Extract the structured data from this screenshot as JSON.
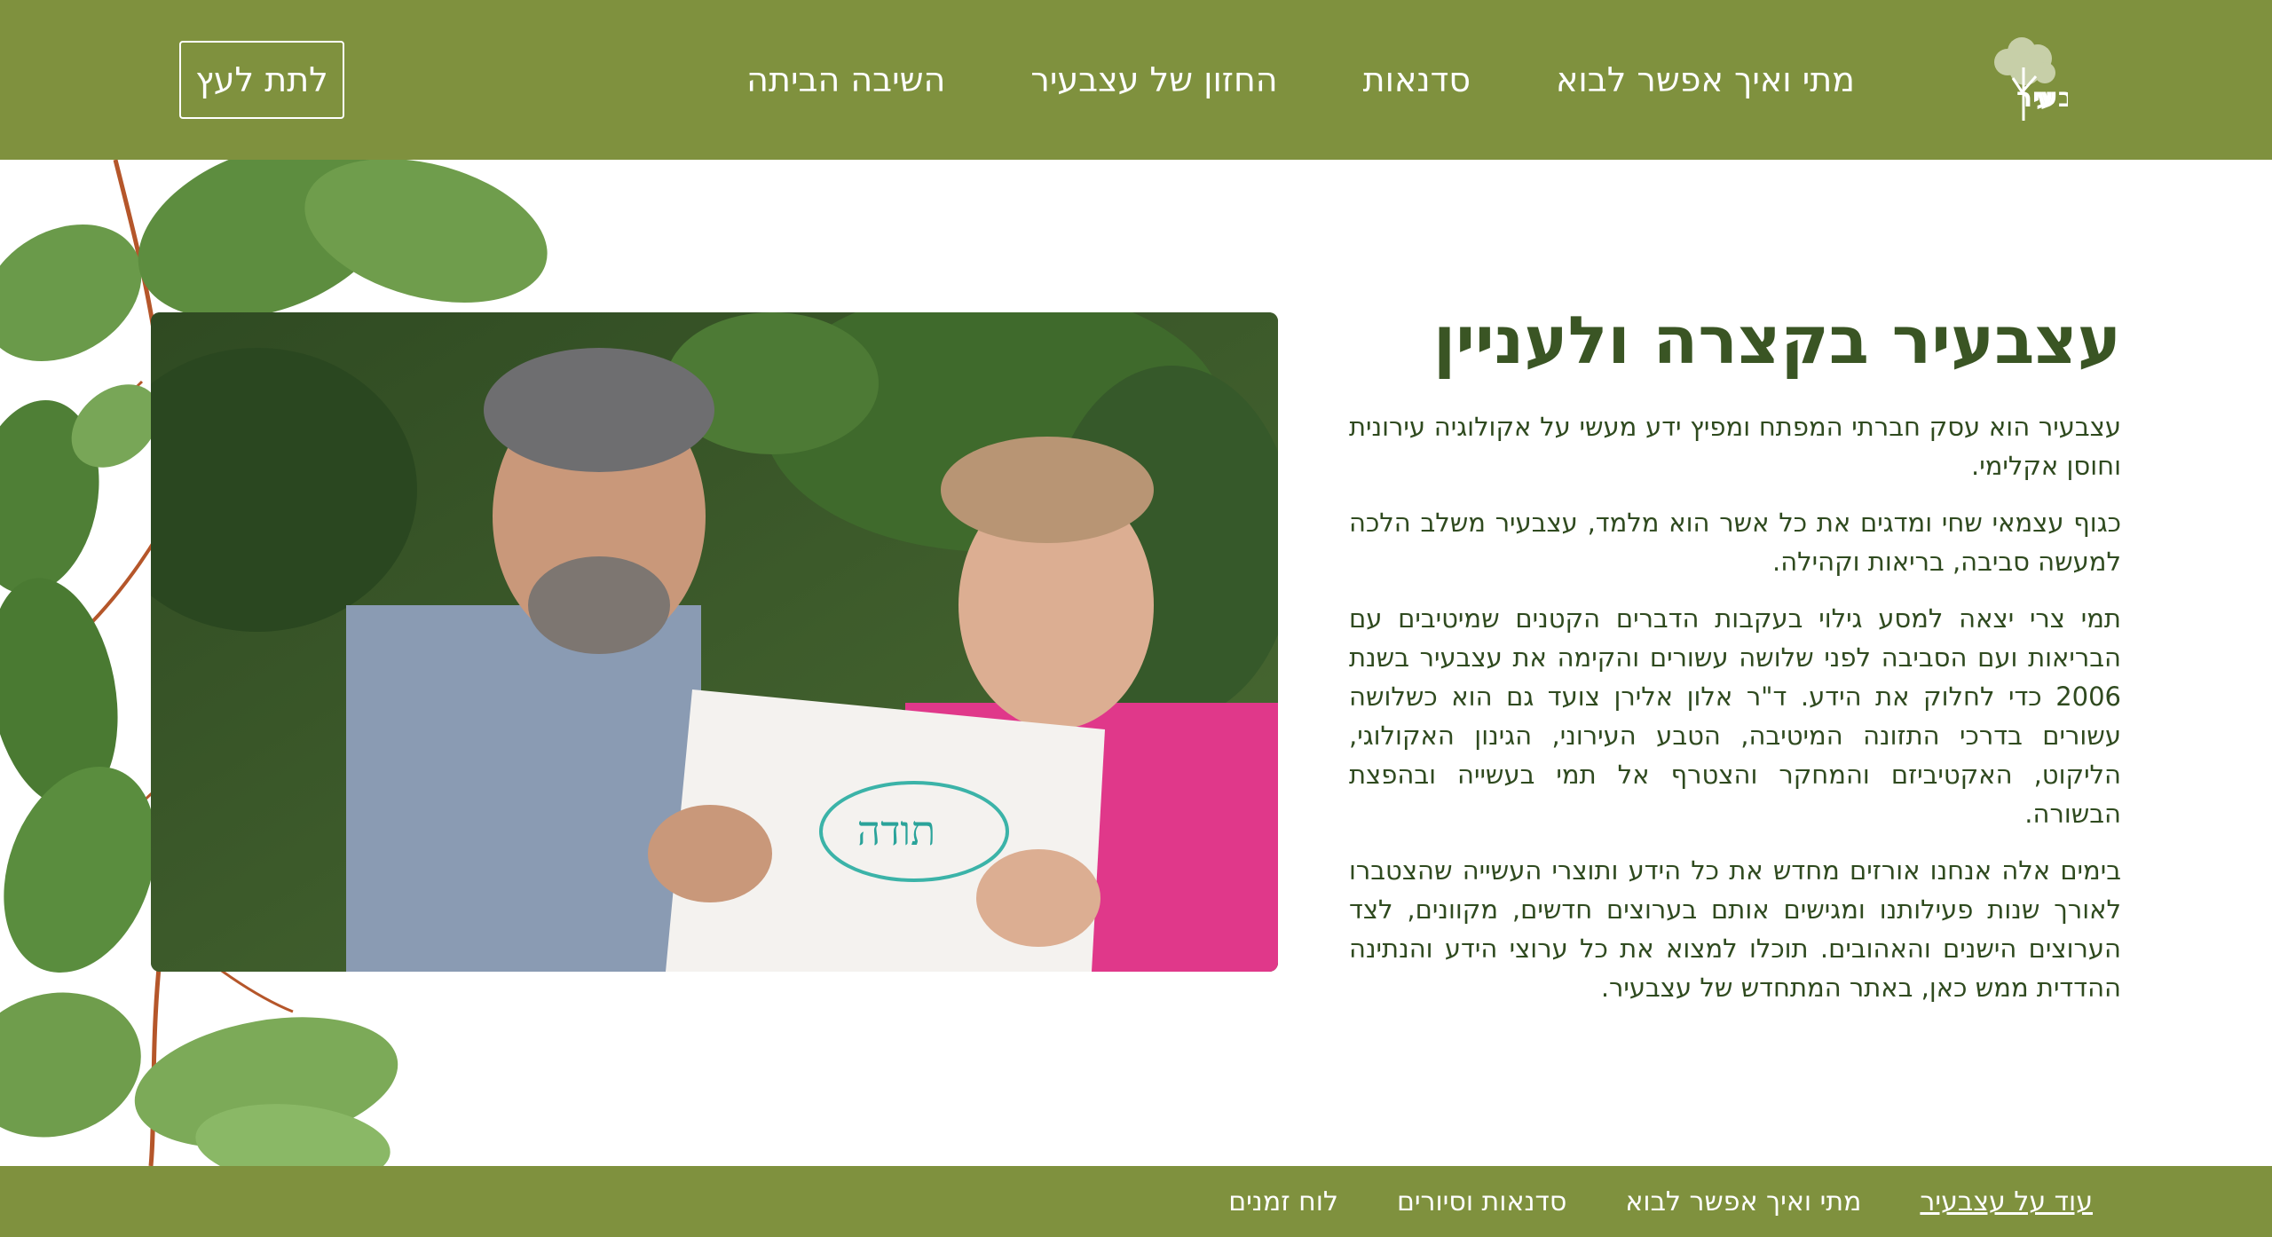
{
  "header": {
    "logo_text": "עץ בעיר",
    "nav": [
      {
        "label": "מתי ואיך אפשר לבוא"
      },
      {
        "label": "סדנאות"
      },
      {
        "label": "החזון של עצבעיר"
      },
      {
        "label": "השיבה הביתה"
      }
    ],
    "donate_label": "לתת לעץ"
  },
  "main": {
    "title": "עצבעיר בקצרה ולעניין",
    "paragraphs": [
      "עצבעיר הוא עסק חברתי המפתח ומפיץ ידע מעשי על אקולוגיה עירונית וחוסן אקלימי.",
      "כגוף עצמאי שחי ומדגים את כל אשר הוא מלמד, עצבעיר משלב הלכה למעשה סביבה, בריאות וקהילה.",
      "תמי צרי יצאה למסע גילוי בעקבות הדברים הקטנים שמיטיבים עם הבריאות ועם הסביבה לפני שלושה עשורים והקימה את עצבעיר בשנת 2006 כדי לחלוק את הידע. ד\"ר אלון אלירן צועד גם הוא כשלושה עשורים בדרכי התזונה המיטיבה, הטבע העירוני, הגינון האקולוגי, הליקוט, האקטיביזם והמחקר והצטרף אל תמי בעשייה ובהפצת הבשורה.",
      "בימים אלה אנחנו אורזים מחדש את כל הידע ותוצרי העשייה שהצטברו לאורך שנות פעילותנו ומגישים אותם בערוצים חדשים, מקוונים, לצד הערוצים הישנים והאהובים. תוכלו למצוא את כל ערוצי הידע והנתינה ההדדית ממש כאן, באתר המתחדש של עצבעיר."
    ],
    "photo": {
      "card_text": "תודה"
    }
  },
  "footer": {
    "links": [
      {
        "label": "עוד על עצבעיר",
        "active": true
      },
      {
        "label": "מתי ואיך אפשר לבוא",
        "active": false
      },
      {
        "label": "סדנאות וסיורים",
        "active": false
      },
      {
        "label": "לוח זמנים",
        "active": false
      }
    ]
  },
  "colors": {
    "brand_green": "#7f913e",
    "title_green": "#3a5524",
    "text_green": "#2f4a1f"
  },
  "icons": {
    "logo": "tree-logo-icon"
  }
}
